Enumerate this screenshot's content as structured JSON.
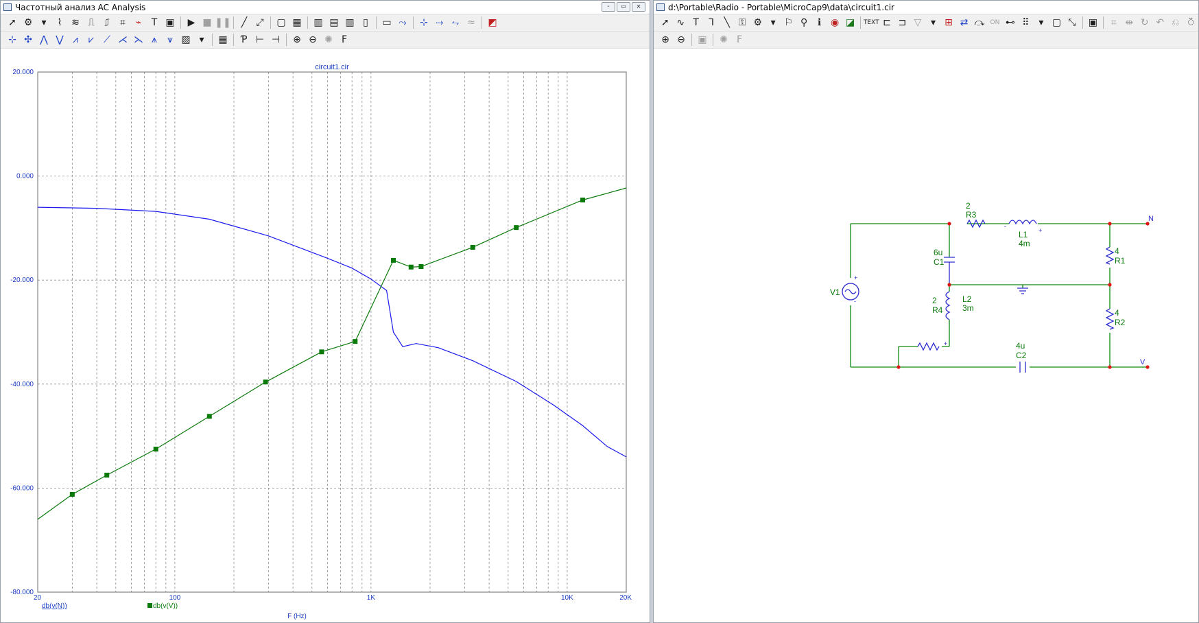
{
  "left_window": {
    "title": "Частотный анализ AC Analysis",
    "controls": {
      "minimize": "-",
      "restore": "▭",
      "close": "✕"
    },
    "toolbar1_icons": [
      "select-arrow-icon",
      "component-icon",
      "dropdown-icon",
      "graph-icon",
      "graph-icon",
      "graph-icon",
      "graph-icon",
      "graph-icon",
      "graph-icon",
      "text-icon",
      "capture-icon",
      "run-icon",
      "stop-icon",
      "pause-icon",
      "line-icon",
      "diag-icon",
      "frame-icon",
      "grid-icon",
      "grid-icon",
      "grid-icon",
      "grid-icon",
      "grid-icon",
      "scale-icon",
      "cursor-icon",
      "cursor-icon",
      "cursor-icon",
      "cursor-icon",
      "cursor-icon"
    ],
    "toolbar2_icons": [
      "peak-icon",
      "valley-icon",
      "high-icon",
      "low-icon",
      "slope-icon",
      "slope-icon",
      "slope-icon",
      "slope-icon",
      "slope-icon",
      "slope-icon",
      "package-icon",
      "table-icon",
      "point-icon",
      "tag-icon",
      "tag-icon",
      "zoom-in-icon",
      "zoom-out-icon",
      "settings-icon",
      "font-icon"
    ]
  },
  "right_window": {
    "title": "d:\\Portable\\Radio - Portable\\MicroCap9\\data\\circuit1.cir",
    "toolbar1_icons": [
      "select-arrow-icon",
      "wire-icon",
      "text-icon",
      "bus-icon",
      "line-icon",
      "ground-icon",
      "component-icon",
      "flag-icon",
      "pin-icon",
      "info-icon",
      "node-icon",
      "color-icon",
      "text-mode-icon",
      "ic-icon",
      "probe-icon",
      "voltage-icon",
      "dropdown-icon",
      "tag-icon",
      "arrow-icon",
      "rotate-icon",
      "on-icon",
      "line-icon",
      "grid-icon",
      "dropdown-icon",
      "square-icon",
      "pointer-icon",
      "page-icon",
      "grid-icon",
      "move-icon",
      "rotate-icon",
      "undo-icon",
      "redo-icon",
      "curve-icon",
      "gauge-icon"
    ],
    "toolbar2_icons": [
      "zoom-in-icon",
      "zoom-out-icon",
      "page-icon",
      "settings-icon",
      "font-icon"
    ]
  },
  "chart_data": {
    "type": "line",
    "title": "circuit1.cir",
    "xlabel": "F (Hz)",
    "xscale": "log",
    "xlim": [
      20,
      20000
    ],
    "ylim": [
      -80,
      20
    ],
    "x_ticks": [
      "20",
      "100",
      "1K",
      "10K",
      "20K"
    ],
    "y_ticks": [
      "20.000",
      "0.000",
      "-20.000",
      "-40.000",
      "-60.000",
      "-80.000"
    ],
    "grid": true,
    "colors": {
      "series1": "#1a1aee",
      "series2": "#0a7a0a",
      "axis_text": "#1b3fc5",
      "grid": "#8a8a8a"
    },
    "series": [
      {
        "name": "db(v(N))",
        "markers": false,
        "points": [
          [
            20,
            -6.0
          ],
          [
            40,
            -6.2
          ],
          [
            80,
            -6.8
          ],
          [
            150,
            -8.3
          ],
          [
            300,
            -11.5
          ],
          [
            600,
            -15.8
          ],
          [
            800,
            -17.7
          ],
          [
            1000,
            -19.8
          ],
          [
            1200,
            -22.0
          ],
          [
            1300,
            -30.0
          ],
          [
            1450,
            -32.8
          ],
          [
            1700,
            -32.2
          ],
          [
            2200,
            -33.0
          ],
          [
            3300,
            -35.5
          ],
          [
            5500,
            -39.5
          ],
          [
            8500,
            -44.0
          ],
          [
            12000,
            -48.0
          ],
          [
            16000,
            -52.0
          ],
          [
            20000,
            -54.0
          ]
        ]
      },
      {
        "name": "db(v(V))",
        "markers": true,
        "points": [
          [
            20,
            -66.0
          ],
          [
            30,
            -61.2
          ],
          [
            45,
            -57.5
          ],
          [
            80,
            -52.5
          ],
          [
            150,
            -46.2
          ],
          [
            290,
            -39.6
          ],
          [
            560,
            -33.8
          ],
          [
            830,
            -31.8
          ],
          [
            1300,
            -16.2
          ],
          [
            1600,
            -17.5
          ],
          [
            1800,
            -17.4
          ],
          [
            3300,
            -13.7
          ],
          [
            5500,
            -9.9
          ],
          [
            12000,
            -4.6
          ],
          [
            20000,
            -2.3
          ]
        ]
      }
    ]
  },
  "schematic": {
    "components": {
      "V1": {
        "ref": "V1",
        "plus": "+",
        "minus": "-"
      },
      "R3": {
        "ref": "R3",
        "value": "2"
      },
      "L1": {
        "ref": "L1",
        "value": "4m",
        "minus": "-",
        "plus": "+"
      },
      "C1": {
        "ref": "C1",
        "value": "6u"
      },
      "L2": {
        "ref": "L2",
        "value": "3m"
      },
      "R4": {
        "ref": "R4",
        "value": "2",
        "plus": "+"
      },
      "R1": {
        "ref": "R1",
        "value": "4"
      },
      "R2": {
        "ref": "R2",
        "value": "4"
      },
      "C2": {
        "ref": "C2",
        "value": "4u"
      }
    },
    "nodes": {
      "N": "N",
      "V": "V"
    },
    "colors": {
      "wire": "#0a8a0a",
      "part": "#2b2bd0",
      "label": "#0a7a0a",
      "node_dot": "#e01515"
    }
  }
}
